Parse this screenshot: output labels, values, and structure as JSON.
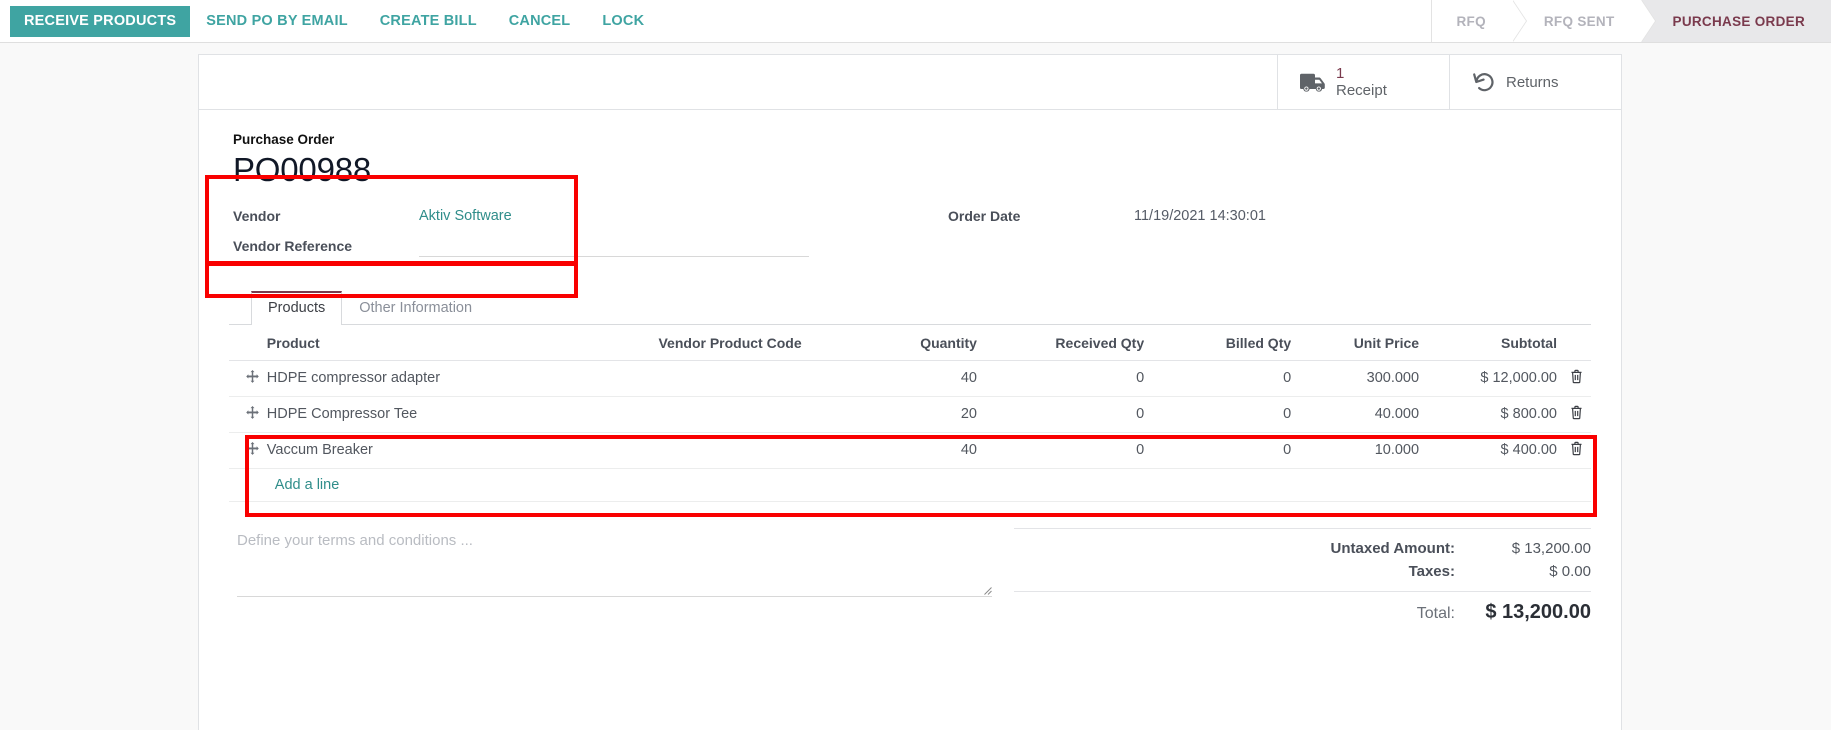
{
  "colors": {
    "accent_teal": "#3fa4a2",
    "status_active": "#7a3a4d",
    "annotation_red": "#f90000",
    "page_bg": "#f9f9f9"
  },
  "control_panel": {
    "buttons": [
      {
        "label": "RECEIVE PRODUCTS",
        "style": "primary"
      },
      {
        "label": "SEND PO BY EMAIL",
        "style": "link"
      },
      {
        "label": "CREATE BILL",
        "style": "link"
      },
      {
        "label": "CANCEL",
        "style": "link"
      },
      {
        "label": "LOCK",
        "style": "link"
      }
    ],
    "statusbar": [
      {
        "label": "RFQ",
        "active": false
      },
      {
        "label": "RFQ SENT",
        "active": false
      },
      {
        "label": "PURCHASE ORDER",
        "active": true
      }
    ]
  },
  "smart_buttons": [
    {
      "icon": "truck-icon",
      "value": "1",
      "label": "Receipt"
    },
    {
      "icon": "return-arrow-icon",
      "value": "",
      "label": "Returns"
    }
  ],
  "header": {
    "title_label": "Purchase Order",
    "title_value": "PO00988",
    "fields_left": [
      {
        "label": "Vendor",
        "value": "Aktiv Software",
        "type": "link"
      },
      {
        "label": "Vendor Reference",
        "value": "",
        "type": "input"
      }
    ],
    "fields_right": [
      {
        "label": "Order Date",
        "value": "11/19/2021 14:30:01",
        "type": "text"
      }
    ]
  },
  "notebook": {
    "tabs": [
      {
        "label": "Products",
        "active": true
      },
      {
        "label": "Other Information",
        "active": false
      }
    ]
  },
  "order_lines": {
    "columns": [
      "Product",
      "Vendor Product Code",
      "Quantity",
      "Received Qty",
      "Billed Qty",
      "Unit Price",
      "Subtotal"
    ],
    "rows": [
      {
        "product": "HDPE compressor adapter",
        "vendor_product_code": "",
        "quantity": "40",
        "received_qty": "0",
        "billed_qty": "0",
        "unit_price": "300.000",
        "subtotal": "$ 12,000.00"
      },
      {
        "product": "HDPE Compressor Tee",
        "vendor_product_code": "",
        "quantity": "20",
        "received_qty": "0",
        "billed_qty": "0",
        "unit_price": "40.000",
        "subtotal": "$ 800.00"
      },
      {
        "product": "Vaccum Breaker",
        "vendor_product_code": "",
        "quantity": "40",
        "received_qty": "0",
        "billed_qty": "0",
        "unit_price": "10.000",
        "subtotal": "$ 400.00"
      }
    ],
    "add_line_label": "Add a line"
  },
  "terms": {
    "placeholder": "Define your terms and conditions ...",
    "value": ""
  },
  "totals": {
    "untaxed_label": "Untaxed Amount:",
    "untaxed_value": "$ 13,200.00",
    "taxes_label": "Taxes:",
    "taxes_value": "$ 0.00",
    "total_label": "Total:",
    "total_value": "$ 13,200.00"
  }
}
